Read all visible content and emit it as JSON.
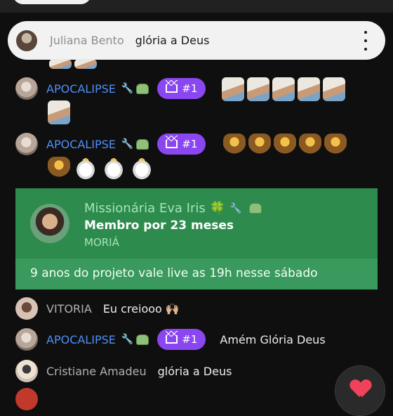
{
  "pinned": {
    "name": "Juliana Bento",
    "message": "glória a Deus"
  },
  "rows": [
    {
      "name": "APOCALIPSE",
      "badge": "#1",
      "message": ""
    },
    {
      "name": "APOCALIPSE",
      "badge": "#1",
      "message": ""
    }
  ],
  "member_card": {
    "name": "Missionária Eva Iris",
    "duration": "Membro por 23 meses",
    "level": "MORIÁ",
    "message": "9 anos do projeto vale live as 19h nesse sábado"
  },
  "messages": [
    {
      "name": "VITORIA",
      "message": "Eu creiooo 🙌🏼"
    },
    {
      "name": "APOCALIPSE",
      "badge": "#1",
      "message": "Amém Glória Deus"
    },
    {
      "name": "Cristiane Amadeu",
      "message": "glória a Deus"
    }
  ],
  "icons": {
    "wrench": "wrench-icon",
    "moderator": "robot-badge-icon",
    "crown": "crown-icon",
    "like": "heart-icon",
    "more": "kebab-menu-icon"
  },
  "colors": {
    "accent_blue": "#4f8ff7",
    "badge_purple": "#8a46f0",
    "member_green": "#2e8b4e",
    "heart_red": "#f0425a"
  }
}
